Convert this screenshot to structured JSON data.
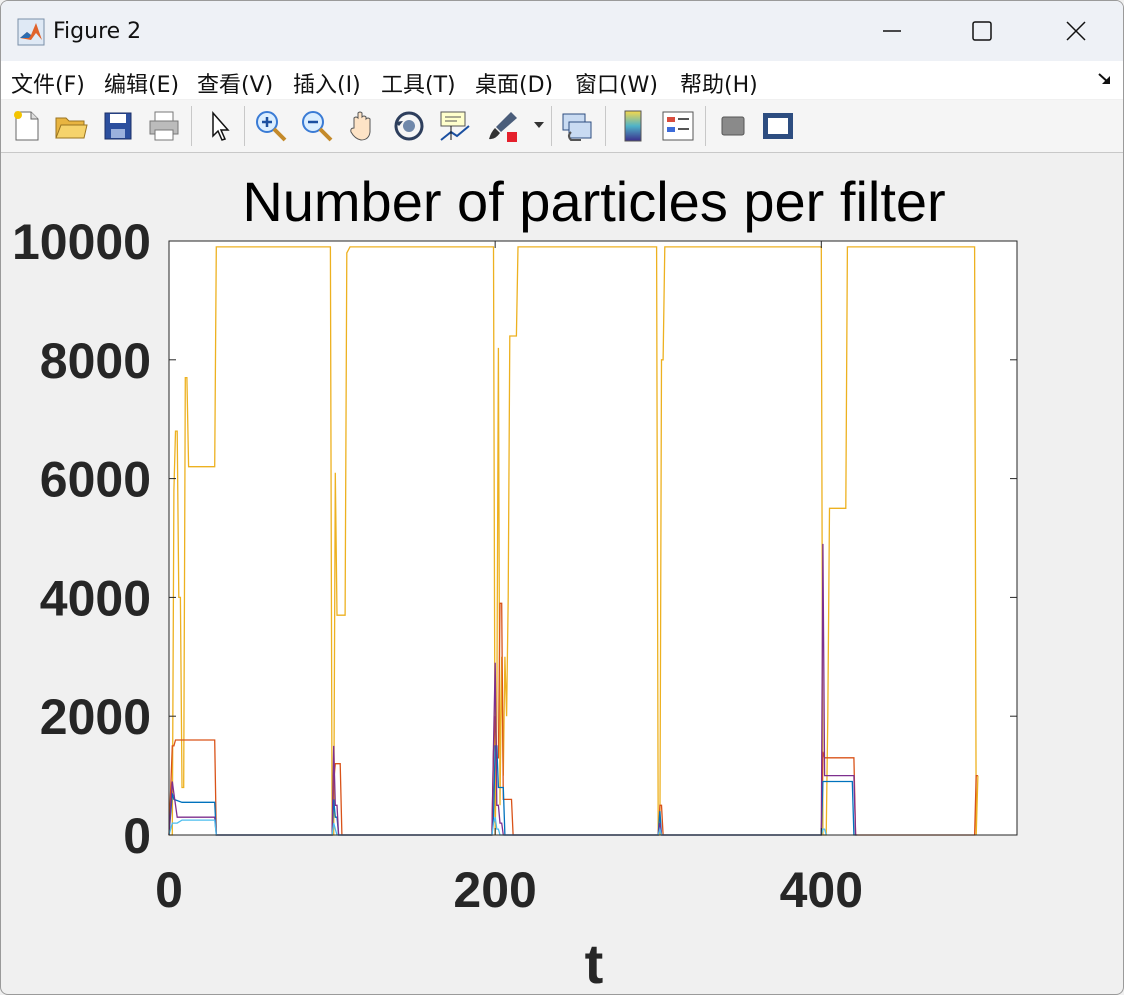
{
  "window": {
    "title": "Figure 2",
    "icon": "matlab-logo-icon",
    "controls": [
      "minimize-icon",
      "maximize-icon",
      "close-icon"
    ]
  },
  "menu": {
    "items": [
      {
        "label": "文件(F)"
      },
      {
        "label": "编辑(E)"
      },
      {
        "label": "查看(V)"
      },
      {
        "label": "插入(I)"
      },
      {
        "label": "工具(T)"
      },
      {
        "label": "桌面(D)"
      },
      {
        "label": "窗口(W)"
      },
      {
        "label": "帮助(H)"
      }
    ],
    "overflow_icon": "dock-arrow-icon"
  },
  "toolbar": {
    "buttons": [
      "new-figure-icon",
      "open-file-icon",
      "save-icon",
      "print-icon",
      "pointer-icon",
      "zoom-in-icon",
      "zoom-out-icon",
      "pan-hand-icon",
      "rotate-3d-icon",
      "data-cursor-icon",
      "brush-icon",
      "link-plot-icon",
      "colorbar-icon",
      "legend-icon",
      "hide-plot-tools-icon",
      "show-plot-tools-icon"
    ]
  },
  "chart_data": {
    "type": "line",
    "title": "Number of particles per filter",
    "xlabel": "t",
    "ylabel": "",
    "xlim": [
      0,
      520
    ],
    "ylim": [
      0,
      10000
    ],
    "xticks": [
      0,
      200,
      400
    ],
    "yticks": [
      0,
      2000,
      4000,
      6000,
      8000,
      10000
    ],
    "xtick_labels": [
      "0",
      "200",
      "400"
    ],
    "ytick_labels": [
      "0",
      "2000",
      "4000",
      "6000",
      "8000",
      "10000"
    ],
    "grid": false,
    "colors": {
      "yellow": "#EDB120",
      "red": "#D95319",
      "blue": "#0072BD",
      "purple": "#7E2F8E",
      "lightblue": "#4DBEEE"
    },
    "series": [
      {
        "color": "#EDB120",
        "x": [
          0,
          2,
          3,
          4,
          5,
          6,
          7,
          8,
          9,
          10,
          11,
          12,
          13,
          14,
          15,
          20,
          25,
          28,
          29,
          30,
          98,
          99,
          100,
          101,
          102,
          103,
          104,
          105,
          106,
          108,
          109,
          110,
          111,
          112,
          113,
          198,
          199,
          200,
          201,
          202,
          203,
          204,
          205,
          206,
          207,
          208,
          209,
          210,
          211,
          212,
          213,
          214,
          215,
          216,
          290,
          298,
          299,
          300,
          301,
          302,
          303,
          304,
          305,
          306,
          307,
          308,
          309,
          310,
          398,
          399,
          400,
          401,
          402,
          403,
          404,
          405,
          406,
          407,
          408,
          409,
          410,
          411,
          412,
          413,
          414,
          415,
          416,
          417,
          418,
          419,
          420,
          480,
          494,
          495,
          496
        ],
        "y": [
          0,
          0,
          5800,
          6800,
          6800,
          4000,
          4000,
          800,
          800,
          7700,
          7700,
          6200,
          6200,
          6200,
          6200,
          6200,
          6200,
          6200,
          9900,
          9900,
          9900,
          9900,
          0,
          0,
          6100,
          3700,
          3700,
          3700,
          3700,
          3700,
          9800,
          9850,
          9900,
          9900,
          9900,
          9900,
          9900,
          0,
          2000,
          8200,
          500,
          3000,
          1000,
          3000,
          2000,
          4000,
          8400,
          8400,
          8400,
          8400,
          8400,
          9900,
          9900,
          9900,
          9900,
          9900,
          9900,
          0,
          0,
          8000,
          8000,
          9900,
          9900,
          9900,
          9900,
          9900,
          9900,
          9900,
          9900,
          9900,
          9900,
          0,
          0,
          0,
          2000,
          5500,
          5500,
          5500,
          5500,
          5500,
          5500,
          5500,
          5500,
          5500,
          5500,
          5500,
          9900,
          9900,
          9900,
          9900,
          9900,
          9900,
          9900,
          0,
          1000
        ]
      },
      {
        "color": "#D95319",
        "x": [
          0,
          2,
          3,
          4,
          8,
          9,
          28,
          29,
          100,
          101,
          102,
          103,
          104,
          105,
          106,
          107,
          198,
          199,
          200,
          201,
          202,
          203,
          204,
          205,
          206,
          210,
          211,
          300,
          301,
          302,
          303,
          304,
          400,
          401,
          402,
          403,
          404,
          405,
          406,
          407,
          408,
          409,
          410,
          411,
          412,
          413,
          414,
          415,
          416,
          417,
          418,
          419,
          420,
          421,
          494,
          495,
          496
        ],
        "y": [
          0,
          1500,
          1500,
          1600,
          1600,
          1600,
          1600,
          0,
          0,
          900,
          1200,
          1200,
          1200,
          1200,
          0,
          0,
          0,
          1400,
          2000,
          1300,
          1300,
          3900,
          3900,
          600,
          600,
          600,
          0,
          0,
          500,
          500,
          0,
          0,
          0,
          1400,
          1300,
          1300,
          1300,
          1300,
          1300,
          1300,
          1300,
          1300,
          1300,
          1300,
          1300,
          1300,
          1300,
          1300,
          1300,
          1300,
          1300,
          1300,
          1300,
          0,
          0,
          1000,
          1000
        ]
      },
      {
        "color": "#0072BD",
        "x": [
          0,
          2,
          3,
          8,
          28,
          29,
          100,
          101,
          102,
          103,
          104,
          105,
          198,
          199,
          200,
          201,
          202,
          203,
          204,
          205,
          206,
          207,
          300,
          301,
          302,
          303,
          400,
          401,
          402,
          403,
          404,
          405,
          406,
          407,
          408,
          409,
          410,
          411,
          412,
          413,
          414,
          415,
          416,
          417,
          418,
          419,
          420,
          421,
          422
        ],
        "y": [
          0,
          700,
          600,
          550,
          550,
          0,
          0,
          600,
          300,
          300,
          0,
          0,
          0,
          300,
          1500,
          1500,
          800,
          800,
          800,
          800,
          0,
          0,
          0,
          400,
          0,
          0,
          0,
          900,
          900,
          900,
          900,
          900,
          900,
          900,
          900,
          900,
          900,
          900,
          900,
          900,
          900,
          900,
          900,
          900,
          900,
          900,
          0,
          0,
          0
        ]
      },
      {
        "color": "#7E2F8E",
        "x": [
          0,
          2,
          3,
          5,
          8,
          28,
          29,
          100,
          101,
          102,
          103,
          104,
          198,
          199,
          200,
          201,
          202,
          203,
          204,
          205,
          206,
          207,
          300,
          301,
          302,
          400,
          401,
          402,
          403,
          404,
          405,
          406,
          407,
          408,
          409,
          410,
          411,
          412,
          413,
          414,
          415,
          416,
          417,
          418,
          419,
          420,
          421
        ],
        "y": [
          0,
          900,
          700,
          300,
          300,
          300,
          0,
          0,
          1500,
          500,
          500,
          0,
          0,
          1500,
          2900,
          500,
          500,
          200,
          200,
          0,
          0,
          0,
          0,
          200,
          0,
          0,
          4900,
          1000,
          1000,
          1000,
          1000,
          1000,
          1000,
          1000,
          1000,
          1000,
          1000,
          1000,
          1000,
          1000,
          1000,
          1000,
          1000,
          1000,
          1000,
          1000,
          0
        ]
      },
      {
        "color": "#4DBEEE",
        "x": [
          0,
          2,
          5,
          8,
          28,
          29,
          100,
          101,
          102,
          103,
          104,
          198,
          199,
          200,
          201,
          202,
          203,
          300,
          301,
          302,
          400,
          401,
          402,
          403
        ],
        "y": [
          0,
          200,
          200,
          250,
          250,
          0,
          0,
          200,
          100,
          0,
          0,
          0,
          200,
          300,
          100,
          100,
          0,
          0,
          100,
          0,
          0,
          100,
          100,
          0
        ]
      }
    ]
  }
}
